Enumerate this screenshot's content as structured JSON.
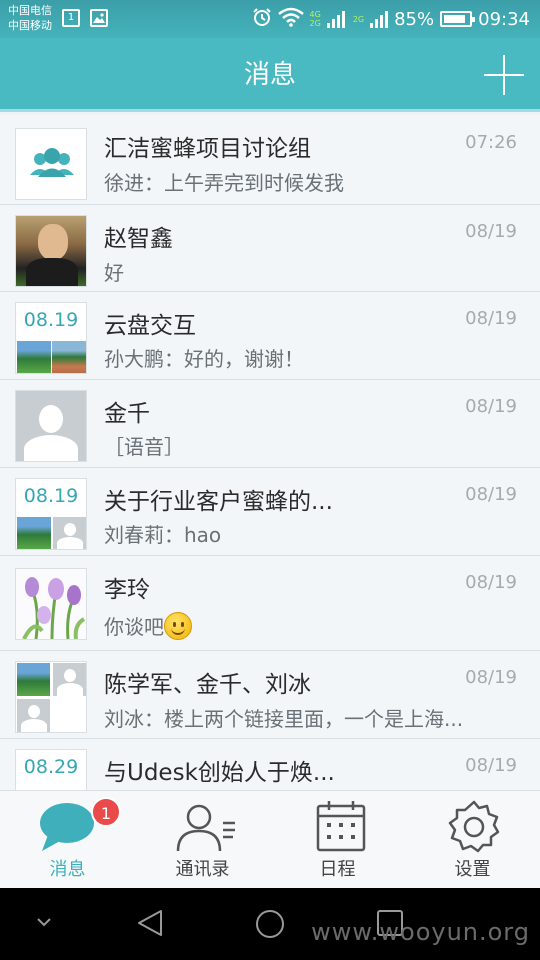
{
  "status_bar": {
    "carriers": [
      "中国电信",
      "中国移动"
    ],
    "box1": "1",
    "net_tags": [
      "4G",
      "2G"
    ],
    "net_tag2": "2G",
    "battery_text": "85%",
    "battery_level": 0.85,
    "time": "09:34"
  },
  "header": {
    "title": "消息"
  },
  "conversations": [
    {
      "name": "汇洁蜜蜂项目讨论组",
      "message": "徐进：上午弄完到时候发我",
      "time": "07:26"
    },
    {
      "name": "赵智鑫",
      "message": "好",
      "time": "08/19"
    },
    {
      "name": "云盘交互",
      "message": "孙大鹏：好的，谢谢！",
      "time": "08/19",
      "date_label": "08.19"
    },
    {
      "name": "金千",
      "message": "［语音］",
      "time": "08/19"
    },
    {
      "name": "关于行业客户蜜蜂的...",
      "message": "刘春莉：hao",
      "time": "08/19",
      "date_label": "08.19"
    },
    {
      "name": "李玲",
      "message": "你谈吧",
      "time": "08/19"
    },
    {
      "name": "陈学军、金千、刘冰",
      "message": "刘冰：楼上两个链接里面，一个是上海...",
      "time": "08/19"
    },
    {
      "name": "与Udesk创始人于焕...",
      "message": "",
      "time": "08/19",
      "date_label": "08.29"
    }
  ],
  "tabs": [
    {
      "label": "消息",
      "badge": "1"
    },
    {
      "label": "通讯录"
    },
    {
      "label": "日程"
    },
    {
      "label": "设置"
    }
  ],
  "watermark": "www.wooyun.org",
  "colors": {
    "accent": "#49b9c2",
    "active_tab": "#3fb0bb",
    "badge": "#ea4a4a",
    "time_text": "#a4abb0"
  }
}
